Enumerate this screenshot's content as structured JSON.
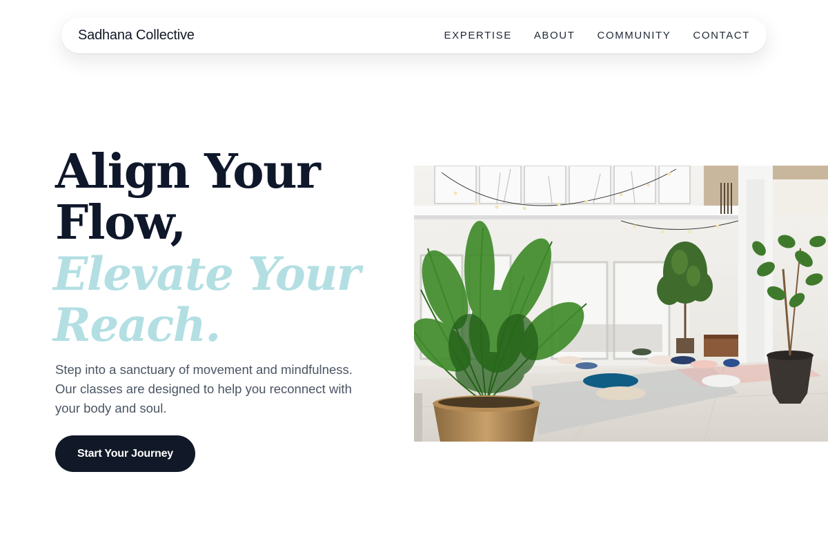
{
  "nav": {
    "brand": "Sadhana Collective",
    "links": [
      {
        "label": "EXPERTISE"
      },
      {
        "label": "ABOUT"
      },
      {
        "label": "COMMUNITY"
      },
      {
        "label": "CONTACT"
      }
    ]
  },
  "hero": {
    "headline_line1": "Align Your Flow,",
    "headline_line2": "Elevate Your Reach.",
    "subtext": "Step into a sanctuary of movement and mindfulness. Our classes are designed to help you reconnect with your body and soul.",
    "cta_label": "Start Your Journey"
  },
  "colors": {
    "primary": "#111827",
    "accent": "#b3dfe3",
    "body_text": "#4b5563"
  }
}
